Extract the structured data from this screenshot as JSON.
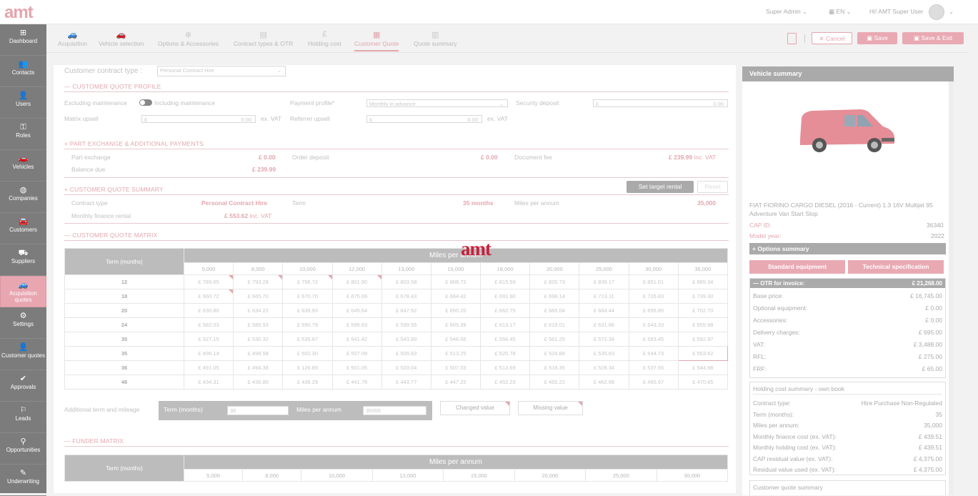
{
  "app": {
    "logo": "amt"
  },
  "topbar": {
    "role": "Super Admin",
    "lang": "EN",
    "greeting": "Hi! AMT Super User"
  },
  "sidebar": [
    {
      "label": "Dashboard",
      "icon": "dashboard-icon",
      "glyph": "⊞"
    },
    {
      "label": "Contacts",
      "icon": "contacts-icon",
      "glyph": "👥"
    },
    {
      "label": "Users",
      "icon": "users-icon",
      "glyph": "👤"
    },
    {
      "label": "Roles",
      "icon": "roles-icon",
      "glyph": "⚿"
    },
    {
      "label": "Vehicles",
      "icon": "vehicles-icon",
      "glyph": "🚗"
    },
    {
      "label": "Companies",
      "icon": "companies-icon",
      "glyph": "◍"
    },
    {
      "label": "Customers",
      "icon": "customers-icon",
      "glyph": "🚘"
    },
    {
      "label": "Suppliers",
      "icon": "suppliers-icon",
      "glyph": "⛟"
    },
    {
      "label": "Acquisition quotes",
      "icon": "acquisition-quotes-icon",
      "glyph": "🚙"
    },
    {
      "label": "Settings",
      "icon": "settings-icon",
      "glyph": "⚙"
    },
    {
      "label": "Customer quotes",
      "icon": "customer-quotes-icon",
      "glyph": "👤"
    },
    {
      "label": "Approvals",
      "icon": "approvals-icon",
      "glyph": "✔"
    },
    {
      "label": "Leads",
      "icon": "leads-icon",
      "glyph": "⚐"
    },
    {
      "label": "Opportunities",
      "icon": "opportunities-icon",
      "glyph": "⚲"
    },
    {
      "label": "Underwriting",
      "icon": "underwriting-icon",
      "glyph": "✎"
    }
  ],
  "wizard": [
    {
      "label": "Acquisition",
      "glyph": "🚙"
    },
    {
      "label": "Vehicle selection",
      "glyph": "🚗"
    },
    {
      "label": "Options & Accessories",
      "glyph": "⊕"
    },
    {
      "label": "Contract types & OTR",
      "glyph": "▤"
    },
    {
      "label": "Holding cost",
      "glyph": "£"
    },
    {
      "label": "Customer Quote",
      "glyph": "▦"
    },
    {
      "label": "Quote summary",
      "glyph": "▥"
    }
  ],
  "actions": {
    "cancel": "Cancel",
    "save": "Save",
    "save_exit": "Save & Exit"
  },
  "form": {
    "contract_type_label": "Customer contract type :",
    "contract_type_value": "Personal Contract Hire",
    "profile_title": "CUSTOMER QUOTE PROFILE",
    "excl_maint": "Excluding maintenance",
    "incl_maint": "Including maintenance",
    "payment_profile_label": "Payment profile*",
    "payment_profile_value": "Monthly in advance",
    "security_deposit_label": "Security deposit",
    "security_deposit_value": "0.00",
    "currency": "£",
    "matrix_upsell_label": "Matrix upsell",
    "matrix_upsell_value": "0.00",
    "ex_vat": "ex. VAT",
    "referrer_upsell_label": "Referrer upsell",
    "referrer_upsell_value": "0.00",
    "px_title": "PART EXCHANGE & ADDITIONAL PAYMENTS",
    "part_exchange_label": "Part exchange",
    "part_exchange_value": "£ 0.00",
    "order_deposit_label": "Order deposit",
    "order_deposit_value": "£ 0.00",
    "document_fee_label": "Document fee",
    "document_fee_value": "£ 239.99",
    "inc_vat": "inc. VAT",
    "balance_due_label": "Balance due",
    "balance_due_value": "£ 239.99",
    "summary_title": "CUSTOMER QUOTE SUMMARY",
    "set_target": "Set target rental",
    "reset": "Reset",
    "contract_type_s_label": "Contract type",
    "contract_type_s_value": "Personal Contract Hire",
    "term_label": "Term",
    "term_value": "35 months",
    "miles_label": "Miles per annum",
    "miles_value": "35,000",
    "monthly_label": "Monthly finance rental",
    "monthly_value": "£ 553.62",
    "matrix_title": "CUSTOMER QUOTE MATRIX",
    "funder_title": "FUNDER MATRIX",
    "add_term_label": "Additional term and mileage",
    "term_months": "Term (months)",
    "term_input": "35",
    "miles_input_label": "Miles per annum",
    "miles_input": "35000",
    "changed": "Changed value",
    "missing": "Missing value"
  },
  "matrix": {
    "title": "Miles per annum",
    "term_header": "Term (months)",
    "cols": [
      "5,000",
      "8,000",
      "10,000",
      "12,000",
      "13,000",
      "15,000",
      "18,000",
      "20,000",
      "25,000",
      "30,000",
      "35,000"
    ],
    "rows": [
      {
        "term": "12",
        "vals": [
          "£ 789.65",
          "£ 793.28",
          "£ 796.72",
          "£ 801.90",
          "£ 803.58",
          "£ 808.72",
          "£ 815.59",
          "£ 820.73",
          "£ 836.17",
          "£ 851.61",
          "£ 865.34"
        ]
      },
      {
        "term": "18",
        "vals": [
          "£ 660.72",
          "£ 665.70",
          "£ 670.70",
          "£ 675.69",
          "£ 678.43",
          "£ 684.42",
          "£ 691.90",
          "£ 698.14",
          "£ 713.11",
          "£ 726.83",
          "£ 739.30"
        ]
      },
      {
        "term": "20",
        "vals": [
          "£ 630.80",
          "£ 634.22",
          "£ 639.93",
          "£ 645.64",
          "£ 647.92",
          "£ 650.20",
          "£ 662.75",
          "£ 665.04",
          "£ 684.44",
          "£ 695.85",
          "£ 702.70"
        ]
      },
      {
        "term": "24",
        "vals": [
          "£ 582.03",
          "£ 585.93",
          "£ 590.79",
          "£ 596.63",
          "£ 599.55",
          "£ 605.39",
          "£ 613.17",
          "£ 619.01",
          "£ 631.66",
          "£ 643.33",
          "£ 655.98"
        ]
      },
      {
        "term": "30",
        "vals": [
          "£ 527.15",
          "£ 530.32",
          "£ 535.87",
          "£ 541.42",
          "£ 543.80",
          "£ 546.56",
          "£ 556.45",
          "£ 561.25",
          "£ 572.34",
          "£ 583.45",
          "£ 592.97"
        ]
      },
      {
        "term": "35",
        "vals": [
          "£ 496.14",
          "£ 498.58",
          "£ 502.30",
          "£ 507.09",
          "£ 509.83",
          "£ 513.25",
          "£ 520.78",
          "£ 524.88",
          "£ 535.83",
          "£ 544.73",
          "£ 553.62"
        ]
      },
      {
        "term": "36",
        "vals": [
          "£ 491.05",
          "£ 494.38",
          "£ 126.89",
          "£ 501.05",
          "£ 503.04",
          "£ 507.03",
          "£ 513.69",
          "£ 518.35",
          "£ 528.34",
          "£ 537.65",
          "£ 544.98"
        ]
      },
      {
        "term": "48",
        "vals": [
          "£ 434.31",
          "£ 436.80",
          "£ 438.29",
          "£ 441.78",
          "£ 443.77",
          "£ 447.25",
          "£ 452.23",
          "£ 455.22",
          "£ 462.68",
          "£ 465.67",
          "£ 470.65"
        ]
      }
    ]
  },
  "funder": {
    "title": "Miles per annum",
    "term_header": "Term (months)",
    "cols": [
      "5,000",
      "8,000",
      "10,000",
      "12,000",
      "15,000",
      "20,000",
      "25,000",
      "30,000"
    ]
  },
  "watermark": "amt",
  "vehicle": {
    "title": "Vehicle summary",
    "desc": "FIAT FIORINO CARGO DIESEL (2016 - Current) 1.3 16V Multijet 95 Adventure Van Start Stop",
    "cap_id_label": "CAP ID:",
    "cap_id": "36340",
    "model_year_label": "Model year:",
    "model_year": "2022",
    "options_summary": "Options summary",
    "std_equipment": "Standard equipment",
    "tech_spec": "Technical specification",
    "otr_label": "OTR for invoice:",
    "otr_value": "£ 21,268.00",
    "otr_rows": [
      {
        "label": "Base price:",
        "value": "£ 16,745.00"
      },
      {
        "label": "Optional equipment:",
        "value": "£ 0.00"
      },
      {
        "label": "Accessories:",
        "value": "£ 0.00"
      },
      {
        "label": "Delivery charges:",
        "value": "£ 695.00"
      },
      {
        "label": "VAT:",
        "value": "£ 3,488.00"
      },
      {
        "label": "RFL:",
        "value": "£ 275.00"
      },
      {
        "label": "FRF:",
        "value": "£ 65.00"
      }
    ],
    "holding_title": "Holding cost summary - own book",
    "holding_rows": [
      {
        "label": "Contract type:",
        "value": "Hire Purchase Non-Regulated"
      },
      {
        "label": "Term (months):",
        "value": "35"
      },
      {
        "label": "Miles per annum:",
        "value": "35,000"
      },
      {
        "label": "Monthly finance cost (ex. VAT):",
        "value": "£ 439.51"
      },
      {
        "label": "Monthly holding cost (ex. VAT):",
        "value": "£ 439.51"
      },
      {
        "label": "CAP residual value (ex. VAT):",
        "value": "£ 4,375.00"
      },
      {
        "label": "Residual value used (ex. VAT):",
        "value": "£ 4,375.00"
      }
    ],
    "cq_summary": "Customer quote summary"
  }
}
